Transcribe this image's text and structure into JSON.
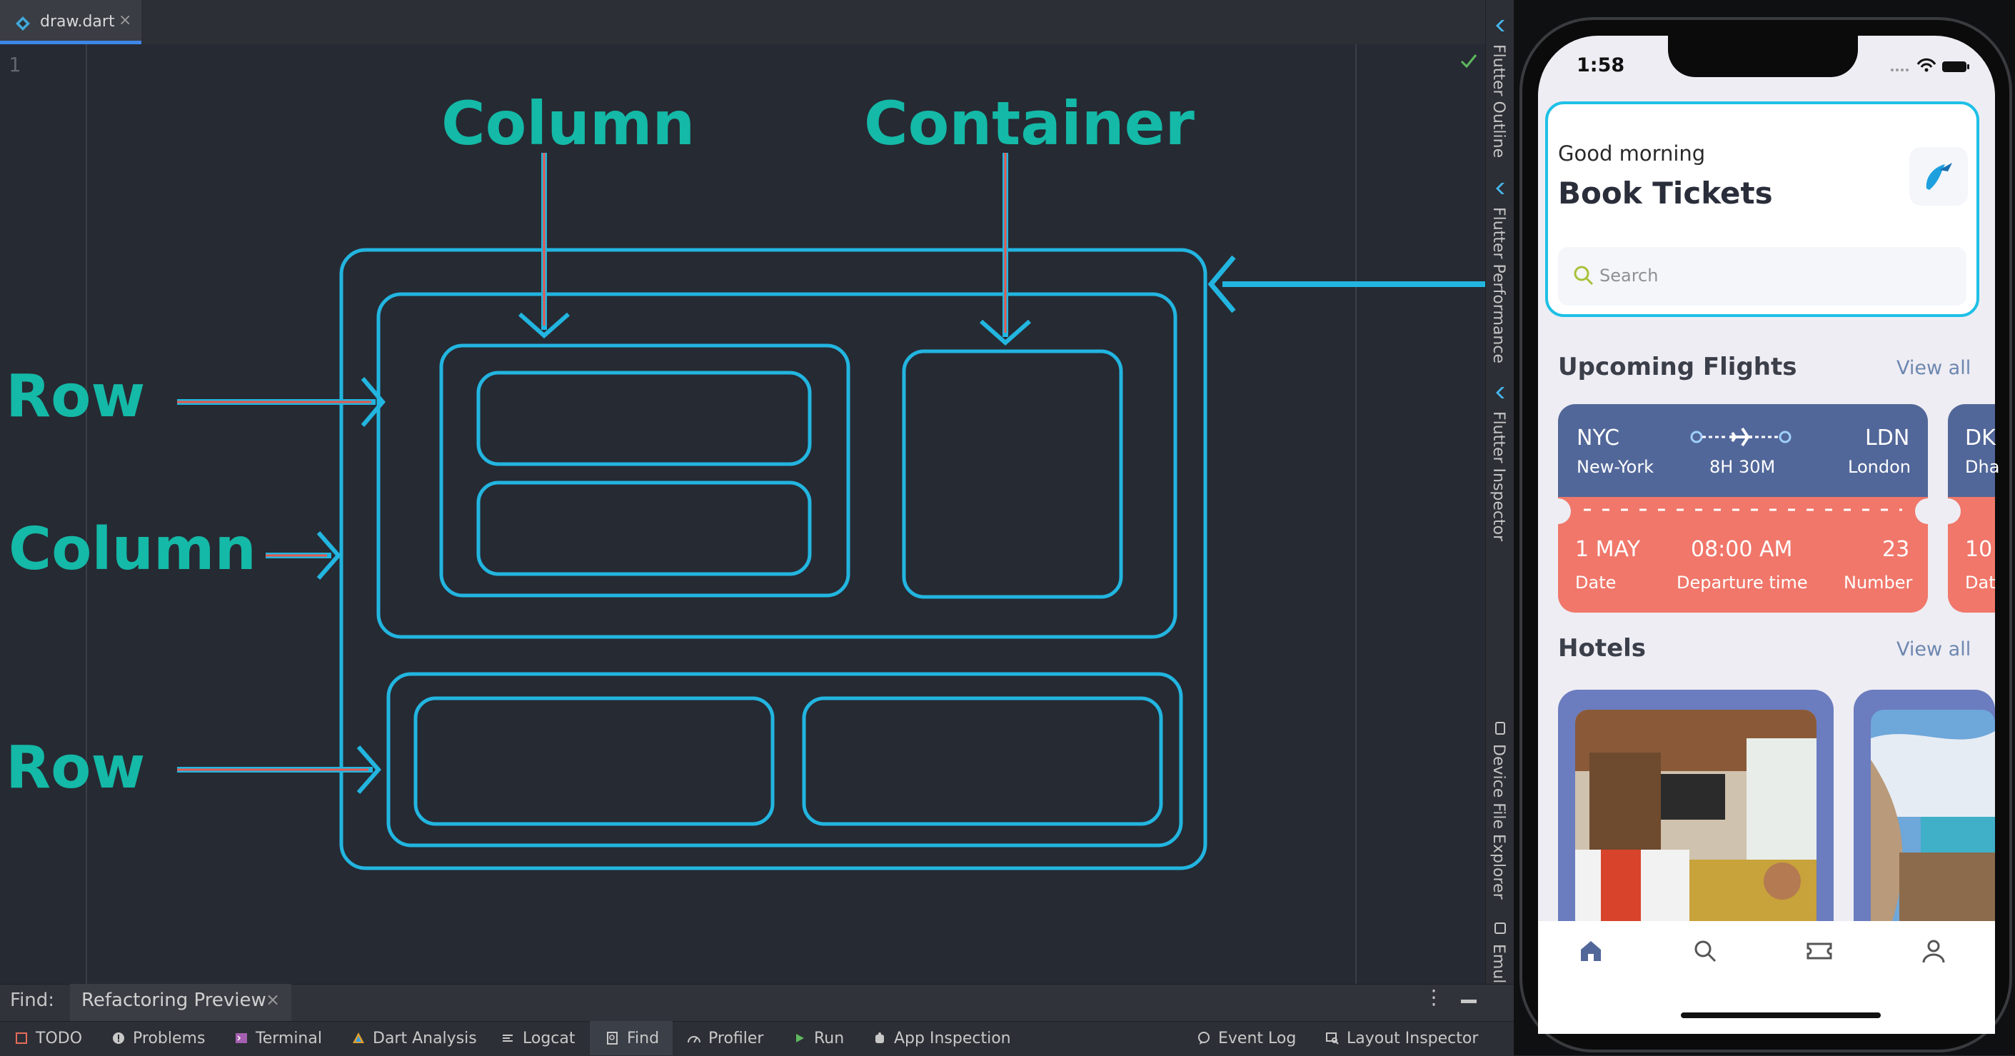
{
  "tab": {
    "filename": "draw.dart",
    "close": "×"
  },
  "editor": {
    "line_number": "1"
  },
  "diagram_labels": {
    "column_top": "Column",
    "container_top": "Container",
    "row_upper": "Row",
    "column_left": "Column",
    "row_lower": "Row"
  },
  "tool_windows": {
    "outline": "Flutter Outline",
    "performance": "Flutter Performance",
    "inspector": "Flutter Inspector",
    "file_explorer": "Device File Explorer",
    "emulator": "Emulator"
  },
  "find_bar": {
    "label": "Find:",
    "tab": "Refactoring Preview",
    "close": "×"
  },
  "status_bar": {
    "todo": "TODO",
    "problems": "Problems",
    "terminal": "Terminal",
    "dart_analysis": "Dart Analysis",
    "logcat": "Logcat",
    "find": "Find",
    "profiler": "Profiler",
    "run": "Run",
    "app_inspection": "App Inspection",
    "event_log": "Event Log",
    "layout_inspector": "Layout Inspector"
  },
  "phone": {
    "time": "1:58",
    "greeting": "Good morning",
    "title": "Book Tickets",
    "search_placeholder": "Search",
    "upcoming_title": "Upcoming Flights",
    "view_all": "View all",
    "hotels_title": "Hotels",
    "hotels_view_all": "View all",
    "flight": {
      "from_code": "NYC",
      "from_city": "New-York",
      "duration": "8H 30M",
      "to_code": "LDN",
      "to_city": "London",
      "date": "1 MAY",
      "date_label": "Date",
      "departure": "08:00 AM",
      "departure_label": "Departure time",
      "number": "23",
      "number_label": "Number"
    },
    "flight2": {
      "from_code": "DK",
      "from_city": "Dha",
      "date": "10",
      "date_label": "Dat"
    }
  },
  "colors": {
    "diagram_stroke": "#22b5e0",
    "label_teal": "#14b9a7",
    "arrow_red": "#e8564a",
    "flight_top": "#526799",
    "flight_bottom": "#f0776a",
    "hotel_card": "#6b7cbf"
  }
}
